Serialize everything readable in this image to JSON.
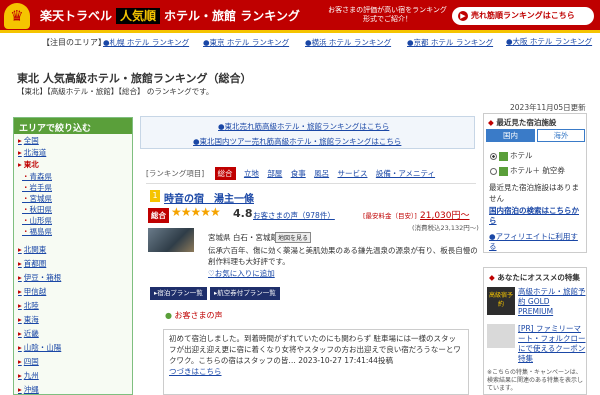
{
  "header": {
    "crown": "♛",
    "brand": "楽天トラベル",
    "badge": "人気順",
    "title": "ホテル・旅館 ランキング",
    "tagline": "お客さまの評価が高い宿をランキング形式でご紹介！",
    "top_link": "売れ筋順ランキングはこちら"
  },
  "area_nav": {
    "label": "【注目のエリア】",
    "links": [
      "札幌 ホテル ランキング",
      "東京 ホテル ランキング",
      "横浜 ホテル ランキング",
      "京都 ホテル ランキング",
      "大阪 ホテル ランキング"
    ]
  },
  "page": {
    "title": "東北 人気高級ホテル・旅館ランキング（総合）",
    "breadcrumb": "【東北】【高級ホテル・旅館】【総合】 のランキングです。",
    "updated": "2023年11月05日更新"
  },
  "sidebar": {
    "heading": "エリアで絞り込む",
    "regions": [
      "全国",
      "北海道",
      "東北",
      "北関東",
      "首都圏",
      "伊豆・箱根",
      "甲信越",
      "北陸",
      "東海",
      "近畿",
      "山陰・山陽",
      "四国",
      "九州",
      "沖縄"
    ],
    "current_region": "東北",
    "prefectures": [
      "青森県",
      "岩手県",
      "宮城県",
      "秋田県",
      "山形県",
      "福島県"
    ]
  },
  "promo_links": [
    "東北売れ筋高級ホテル・旅館ランキングはこちら",
    "東北国内ツアー売れ筋高級ホテル・旅館ランキングはこちら"
  ],
  "sort": {
    "label": "[ランキング項目]",
    "items": [
      "総合",
      "立地",
      "部屋",
      "食事",
      "風呂",
      "サービス",
      "設備・アメニティ"
    ]
  },
  "hotel": {
    "rank_icon": "1",
    "name": "時音の宿　湯主一條",
    "overall": "総合",
    "stars": "★★★★★",
    "score": "4.8",
    "reviews": "お客さまの声（978件）",
    "price_label": "[最安料金（目安）]",
    "price": "21,030円〜",
    "tax": "(消費税込23,132円〜)",
    "address": "宮城県 白石・宮城蔵王",
    "map_btn": "地図を見る",
    "description": "伝承六百年、傷に効く薬湯と美肌効果のある鎌先温泉の源泉が有り、板長自慢の創作料理も大好評です。",
    "fav": "お気に入りに追加",
    "plan_buttons": [
      "宿泊プラン一覧",
      "航空券付プラン一覧"
    ],
    "voice_heading": "お客さまの声",
    "voice_text": "初めて宿泊しました。到着時間がずれていたのにも関わらず 駐車場には一様のスタッフが出迎え迎え更に宿に着くなり女将やスタッフの方お出迎えで良い宿だろうなーとワクワク。こちらの宿はスタッフの皆… 2023-10-27 17:41:44投稿",
    "voice_more": "つづきはこちら"
  },
  "right_panel": {
    "recent_heading": "最近見た宿泊施設",
    "tab_domestic": "国内",
    "tab_overseas": "海外",
    "radio_hotel": "ホテル",
    "radio_hotel_air": "ホテル＋ 航空券",
    "no_recent": "最近見た宿泊施設はありません",
    "search_link": "国内宿泊の検索はこちらから",
    "affiliate": "アフィリエイトに利用する",
    "recommend_heading": "あなたにオススメの特集",
    "ad1_img": "高級宿予約",
    "ad1": "高級ホテル・旅館予約 GOLD PREMIUM",
    "ad2": "[PR] ファミリーマート・フォルクローにで使えるクーポン特集",
    "ad_note": "※こちらの特集・キャンペーンは、検索結果に関連のある特集を表示しています。"
  },
  "colors": {
    "brand_red": "#bf0000",
    "gold": "#f5c400",
    "link": "#1a47a6",
    "sidebar_green": "#5a9f3a"
  }
}
